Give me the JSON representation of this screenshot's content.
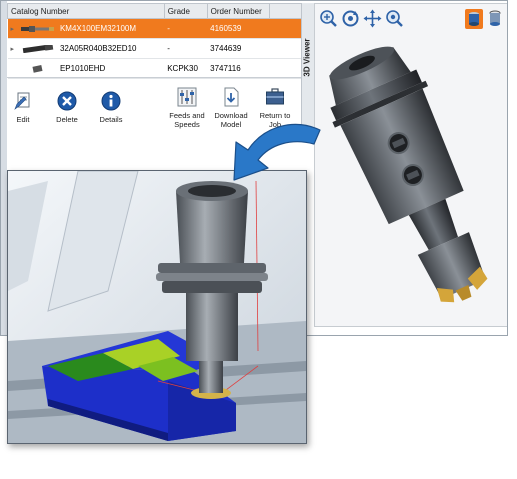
{
  "table": {
    "columns": [
      "Catalog Number",
      "Grade",
      "Order Number"
    ],
    "rows": [
      {
        "catalog": "KM4X100EM32100M",
        "grade": "-",
        "order": "4160539",
        "selected": true
      },
      {
        "catalog": "32A05R040B32ED10",
        "grade": "-",
        "order": "3744639",
        "selected": false
      },
      {
        "catalog": "EP1010EHD",
        "grade": "KCPK30",
        "order": "3747116",
        "selected": false
      }
    ]
  },
  "actions": {
    "edit": "Edit",
    "delete": "Delete",
    "details": "Details",
    "feeds_speeds": "Feeds and Speeds",
    "download_model": "Download Model",
    "return_to": "Return to Job"
  },
  "viewer": {
    "title": "3D Viewer"
  },
  "colors": {
    "selection": "#f07a1e",
    "delete_icon": "#1f5aa8",
    "details_icon": "#1f5aa8",
    "arrow": "#2a78c8"
  }
}
